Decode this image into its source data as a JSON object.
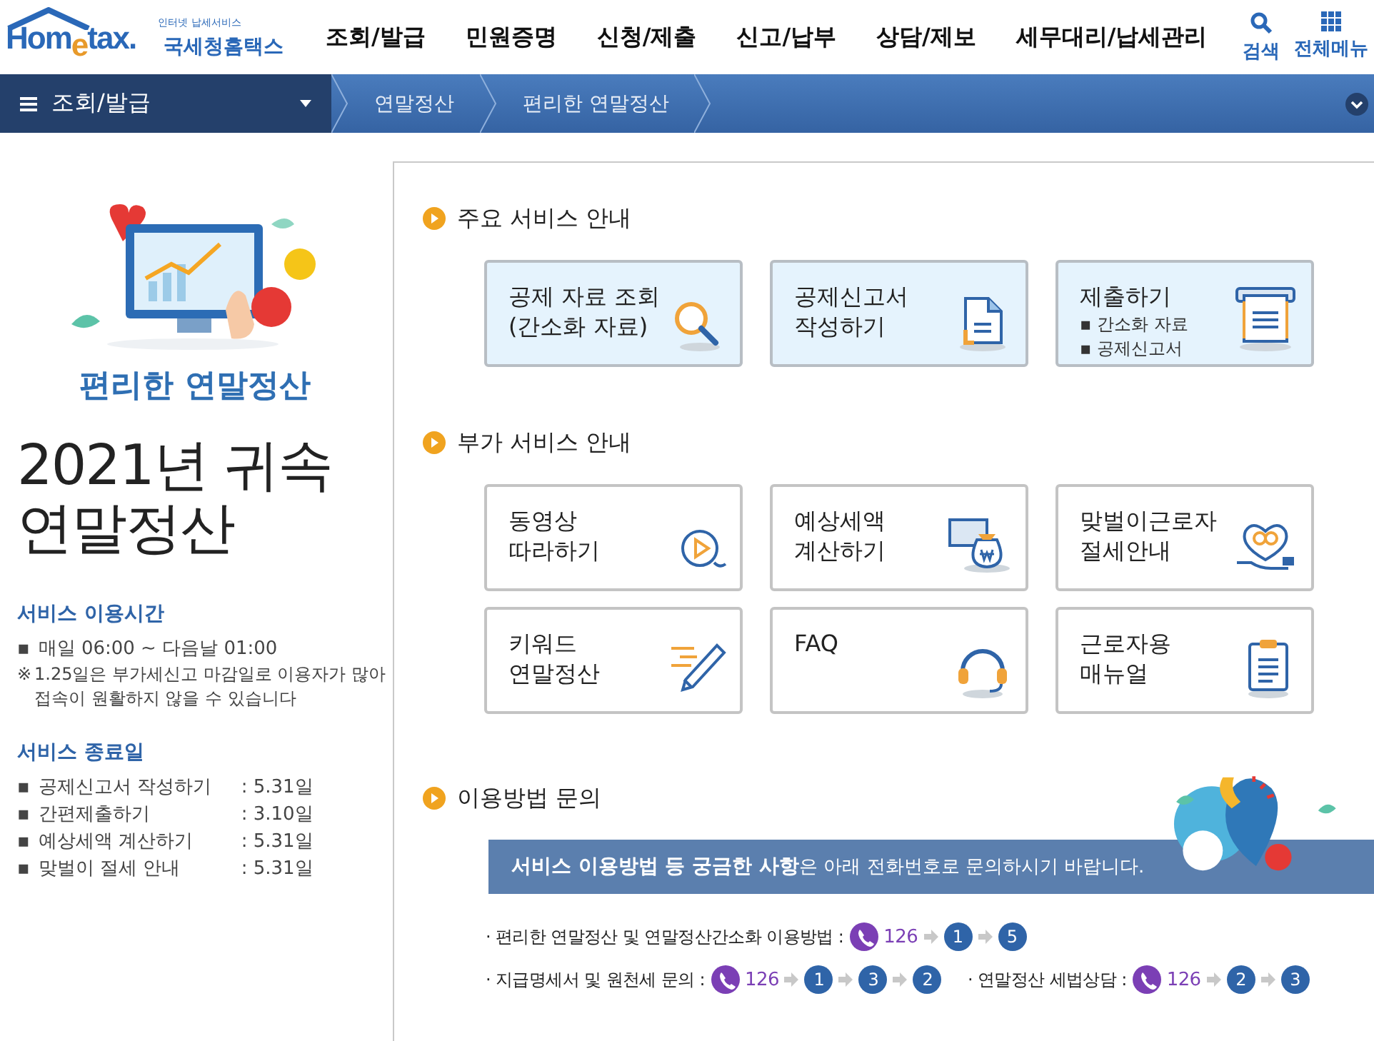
{
  "header": {
    "logo": {
      "tagline": "인터넷 납세서비스",
      "brand": "Hom$_{e}$tax.",
      "name": "국세청홈택스"
    },
    "menu": [
      "조회/발급",
      "민원증명",
      "신청/제출",
      "신고/납부",
      "상담/제보",
      "세무대리/납세관리"
    ],
    "tools": [
      {
        "label": "검색"
      },
      {
        "label": "전체메뉴"
      }
    ]
  },
  "nav": {
    "section": "조회/발급",
    "crumbs": [
      "연말정산",
      "편리한 연말정산"
    ]
  },
  "side": {
    "bullet": "▪",
    "subtitle": "편리한 연말정산",
    "title": [
      "2021년 귀속",
      "연말정산"
    ],
    "hours": {
      "heading": "서비스 이용시간",
      "items": [
        "매일 06:00 ~ 다음날 01:00"
      ],
      "note": "※",
      "note_text": "1.25일은 부가세신고 마감일로 이용자가 많아 접속이 원활하지 않을 수 있습니다"
    },
    "end_dates": {
      "heading": "서비스 종료일",
      "items": [
        {
          "label": "공제신고서 작성하기",
          "date": ": 5.31일"
        },
        {
          "label": "간편제출하기",
          "date": ": 3.10일"
        },
        {
          "label": "예상세액 계산하기",
          "date": ": 5.31일"
        },
        {
          "label": "맞벌이 절세 안내",
          "date": ": 5.31일"
        }
      ]
    }
  },
  "sections": [
    {
      "title": "주요 서비스 안내",
      "kind": "highlight",
      "cards": [
        {
          "title": [
            "공제 자료 조회",
            "(간소화 자료)"
          ]
        },
        {
          "title": [
            "공제신고서",
            "작성하기"
          ]
        },
        {
          "title": [
            "제출하기"
          ],
          "items": [
            "▪ 간소화 자료",
            "▪ 공제신고서"
          ]
        }
      ]
    },
    {
      "title": "부가 서비스 안내",
      "kind": "plain",
      "cards": [
        {
          "title": [
            "동영상",
            "따라하기"
          ]
        },
        {
          "title": [
            "예상세액",
            "계산하기"
          ]
        },
        {
          "title": [
            "맞벌이근로자",
            "절세안내"
          ]
        },
        {
          "title": [
            "키워드",
            "연말정산"
          ]
        },
        {
          "title": [
            "FAQ"
          ]
        },
        {
          "title": [
            "근로자용",
            "매뉴얼"
          ]
        }
      ]
    }
  ],
  "contact": {
    "title": "이용방법 문의",
    "banner": "**서비스 이용방법 등 궁금한 사항**은 아래 전화번호로 문의하시기 바랍니다.",
    "lines": [
      [
        {
          "label": "· 편리한 연말정산 및 연말정산간소화 이용방법 :",
          "phone": "126",
          "steps": [
            "1",
            "5"
          ]
        }
      ],
      [
        {
          "label": "· 지급명세서  및 원천세 문의 :",
          "phone": "126",
          "steps": [
            "1",
            "3",
            "2"
          ]
        },
        {
          "label": "· 연말정산 세법상담  :",
          "phone": "126",
          "steps": [
            "2",
            "3"
          ]
        }
      ]
    ]
  }
}
